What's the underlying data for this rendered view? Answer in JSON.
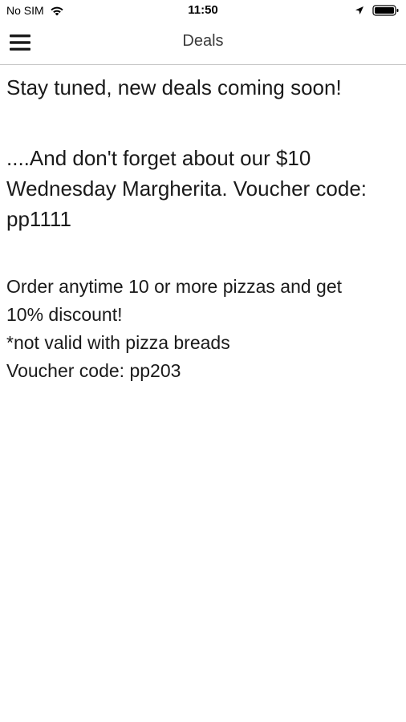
{
  "status_bar": {
    "carrier": "No SIM",
    "time": "11:50"
  },
  "nav": {
    "title": "Deals",
    "menu_icon": "hamburger-menu-icon"
  },
  "content": {
    "headline": "Stay tuned, new deals coming soon!",
    "promo1_line1": "....And don't forget about our $10",
    "promo1_line2": "Wednesday Margherita. Voucher code:",
    "promo1_line3": "pp1111",
    "promo2_line1": "Order anytime 10 or more pizzas and get",
    "promo2_line2": "10% discount!",
    "promo2_line3": "*not valid with pizza breads",
    "promo2_line4": "Voucher code: pp203"
  },
  "colors": {
    "background": "#ffffff",
    "text": "#1a1a1a",
    "divider": "#c8c8c8"
  }
}
